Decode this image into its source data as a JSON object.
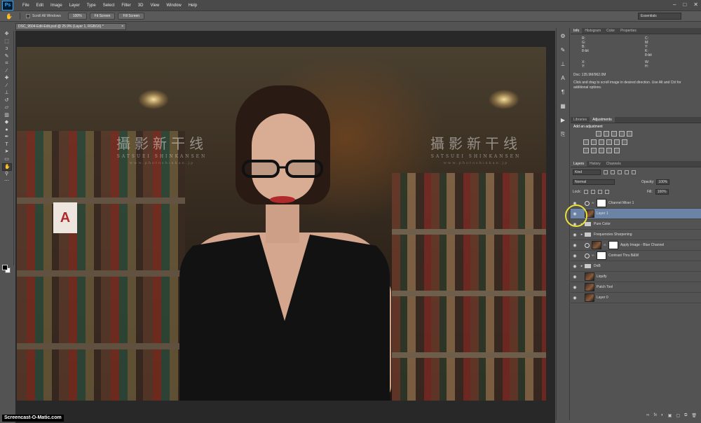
{
  "app": {
    "logo": "Ps"
  },
  "menu": [
    "File",
    "Edit",
    "Image",
    "Layer",
    "Type",
    "Select",
    "Filter",
    "3D",
    "View",
    "Window",
    "Help"
  ],
  "window_controls": [
    "–",
    "□",
    "✕"
  ],
  "options_bar": {
    "scroll_all_label": "Scroll All Windows",
    "btn_100": "100%",
    "btn_fit": "Fit Screen",
    "btn_fill": "Fill Screen",
    "workspace": "Essentials"
  },
  "document": {
    "tab_title": "DSC_9504-Edit-Edit.psd @ 25.9% (Layer 1, RGB/16) *",
    "close": "×"
  },
  "canvas": {
    "wm_left": {
      "cn": "攝影新干线",
      "en": "SATSUEI SHINKANSEN",
      "url": "www.photoshinkan.jp"
    },
    "wm_right": {
      "cn": "攝影新干线",
      "en": "SATSUEI SHINKANSEN",
      "url": "www.photoshinkan.jp"
    },
    "card_letter": "A"
  },
  "info_panel": {
    "tabs": [
      "Info",
      "Histogram",
      "Color",
      "Properties"
    ],
    "left_labels": [
      "R:",
      "G:",
      "B:",
      "8-bit"
    ],
    "right_labels": [
      "C:",
      "M:",
      "Y:",
      "K:",
      "8-bit"
    ],
    "xy_left": [
      "X:",
      "Y:"
    ],
    "xy_right": [
      "W:",
      "H:"
    ],
    "doc": "Doc: 135.9M/962.0M",
    "hint": "Click and drag to scroll image in desired direction. Use Alt and Ctrl for additional options."
  },
  "adjustments_panel": {
    "tabs": [
      "Libraries",
      "Adjustments"
    ],
    "title": "Add an adjustment"
  },
  "layers_panel": {
    "tabs": [
      "Layers",
      "History",
      "Channels"
    ],
    "kind": "Kind",
    "blend": "Normal",
    "opacity_label": "Opacity:",
    "opacity": "100%",
    "lock_label": "Lock:",
    "fill_label": "Fill:",
    "fill": "100%",
    "layers": [
      {
        "name": "Channel Mixer 1",
        "type": "adjustment",
        "selected": false
      },
      {
        "name": "Layer 1",
        "type": "pixel",
        "selected": true
      },
      {
        "name": "Pure Color",
        "type": "group",
        "selected": false
      },
      {
        "name": "Frequencies Sharpening",
        "type": "group",
        "selected": false
      },
      {
        "name": "Apply Image - Blue Channel",
        "type": "masked",
        "selected": false
      },
      {
        "name": "Contrast Thru B&W",
        "type": "adjustment",
        "selected": false
      },
      {
        "name": "DnB",
        "type": "group",
        "selected": false
      },
      {
        "name": "Liquify",
        "type": "pixel",
        "selected": false
      },
      {
        "name": "Patch Tool",
        "type": "pixel",
        "selected": false
      },
      {
        "name": "Layer 0",
        "type": "pixel",
        "selected": false
      }
    ],
    "footer_icons": [
      "fx",
      "◐",
      "▣",
      "▢",
      "⧉",
      "🗑"
    ]
  },
  "recorder_watermark": "Screencast-O-Matic.com",
  "colors": {
    "selected_layer": "#6b84a6",
    "cursor_ring": "#e8e03a",
    "ps_blue": "#31a8ff"
  }
}
